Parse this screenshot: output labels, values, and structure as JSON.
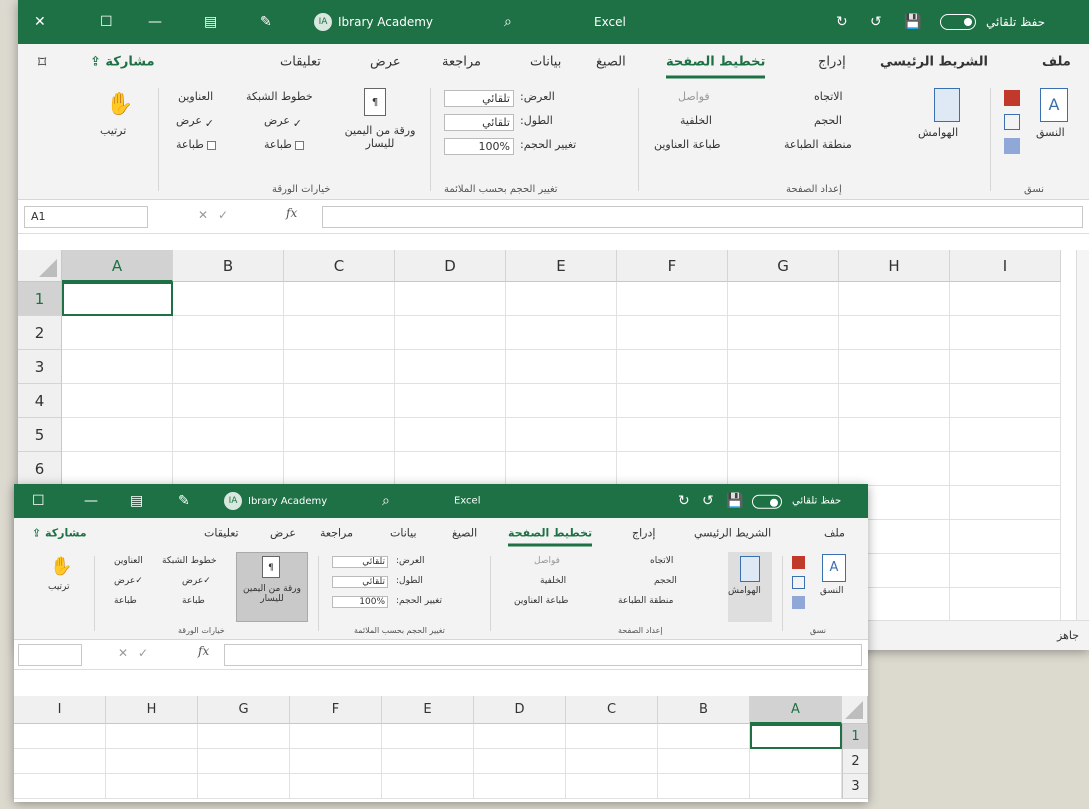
{
  "colors": {
    "brand": "#1e7145",
    "ribbon_bg": "#f3f3f3",
    "grid_line": "#e1e1e1"
  },
  "window": {
    "app": "Excel",
    "user_name": "Ibrary Academy",
    "autosave_label": "حفظ تلقائي",
    "share_label": "مشاركة",
    "comments_label": "تعليقات",
    "tabs": {
      "file": "ملف",
      "home": "الشريط الرئيسي",
      "insert": "إدراج",
      "page_layout": "تخطيط الصفحة",
      "formulas": "الصيغ",
      "data": "بيانات",
      "review": "مراجعة",
      "view": "عرض"
    },
    "ribbon": {
      "themes_group": "نسق",
      "themes_btn": "النسق",
      "margins_btn": "الهوامش",
      "orientation_btn": "الاتجاه",
      "size_btn": "الحجم",
      "print_area_btn": "منطقة الطباعة",
      "breaks_btn": "فواصل",
      "background_btn": "الخلفية",
      "print_titles_btn": "طباعة العناوين",
      "page_setup_group": "إعداد الصفحة",
      "width_label": "العرض:",
      "height_label": "الطول:",
      "scale_label": "تغيير الحجم:",
      "auto_value": "تلقائي",
      "scale_value": "100%",
      "scale_group": "تغيير الحجم بحسب الملائمة",
      "rtl_sheet_btn": "ورقة من اليمين لليسار",
      "gridlines_label": "خطوط الشبكة",
      "headings_label": "العناوين",
      "view_label": "عرض",
      "print_label": "طباعة",
      "sheet_options_group": "خيارات الورقة",
      "arrange_btn": "ترتيب"
    },
    "status_ready": "جاهز"
  },
  "sheet": {
    "name_box": "A1",
    "fx": "fx",
    "columns": [
      "A",
      "B",
      "C",
      "D",
      "E",
      "F",
      "G",
      "H",
      "I"
    ],
    "rows": [
      "1",
      "2",
      "3",
      "4",
      "5",
      "6"
    ]
  },
  "sheet2": {
    "columns": [
      "I",
      "H",
      "G",
      "F",
      "E",
      "D",
      "C",
      "B",
      "A"
    ],
    "rows": [
      "1",
      "2",
      "3"
    ]
  }
}
